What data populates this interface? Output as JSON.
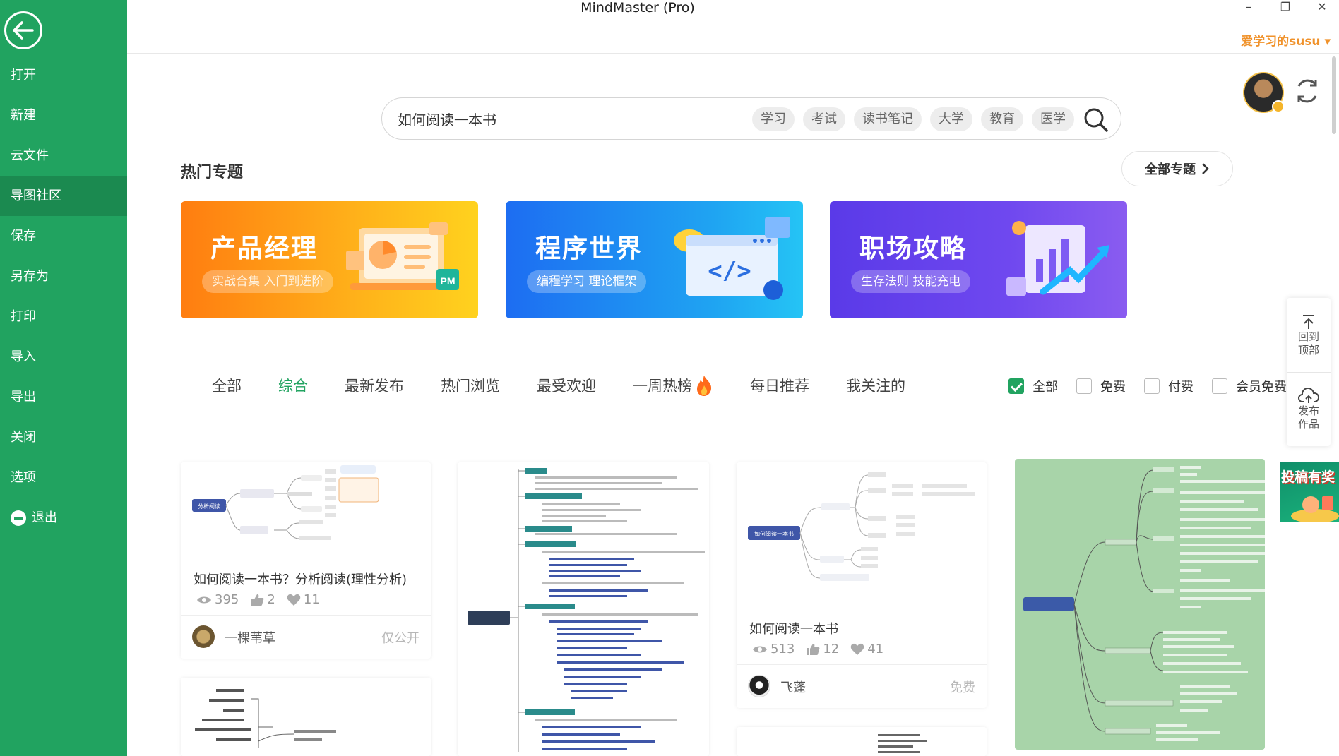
{
  "window": {
    "title": "MindMaster (Pro)",
    "minimize": "–",
    "restore": "❐",
    "close": "✕",
    "user_name": "爱学习的susu ▾"
  },
  "sidebar": {
    "items": [
      {
        "label": "打开"
      },
      {
        "label": "新建"
      },
      {
        "label": "云文件"
      },
      {
        "label": "导图社区"
      },
      {
        "label": "保存"
      },
      {
        "label": "另存为"
      },
      {
        "label": "打印"
      },
      {
        "label": "导入"
      },
      {
        "label": "导出"
      },
      {
        "label": "关闭"
      },
      {
        "label": "选项"
      },
      {
        "label": "退出"
      }
    ],
    "active_index": 3
  },
  "search": {
    "value": "如何阅读一本书",
    "tags": [
      "学习",
      "考试",
      "读书笔记",
      "大学",
      "教育",
      "医学"
    ]
  },
  "hot_topics": {
    "title": "热门专题",
    "all_button": "全部专题",
    "banners": [
      {
        "title": "产品经理",
        "subtitle": "实战合集 入门到进阶",
        "badge": "PM"
      },
      {
        "title": "程序世界",
        "subtitle": "编程学习 理论框架",
        "code": "</>"
      },
      {
        "title": "职场攻略",
        "subtitle": "生存法则 技能充电"
      }
    ]
  },
  "tabs": {
    "items": [
      "全部",
      "综合",
      "最新发布",
      "热门浏览",
      "最受欢迎",
      "一周热榜",
      "每日推荐",
      "我关注的"
    ],
    "active_index": 1
  },
  "price_filter": {
    "options": [
      {
        "label": "全部",
        "checked": true
      },
      {
        "label": "免费",
        "checked": false
      },
      {
        "label": "付费",
        "checked": false
      },
      {
        "label": "会员免费",
        "checked": false
      }
    ]
  },
  "float_panel": {
    "top_label_1": "回到",
    "top_label_2": "顶部",
    "publish_label_1": "发布",
    "publish_label_2": "作品",
    "promo": "投稿有奖"
  },
  "cards": {
    "c1": {
      "title": "如何阅读一本书？分析阅读(理性分析)",
      "views": "395",
      "likes": "2",
      "favs": "11",
      "author": "一棵苇草",
      "price": "仅公开",
      "map_root": "分析阅读"
    },
    "c3": {
      "title": "如何阅读一本书",
      "views": "513",
      "likes": "12",
      "favs": "41",
      "author": "飞蓬",
      "price": "免费",
      "map_root": "如何阅读一本书"
    }
  },
  "colors": {
    "sidebar": "#21a360",
    "accent": "#21a360",
    "user_name": "#f0922b"
  }
}
